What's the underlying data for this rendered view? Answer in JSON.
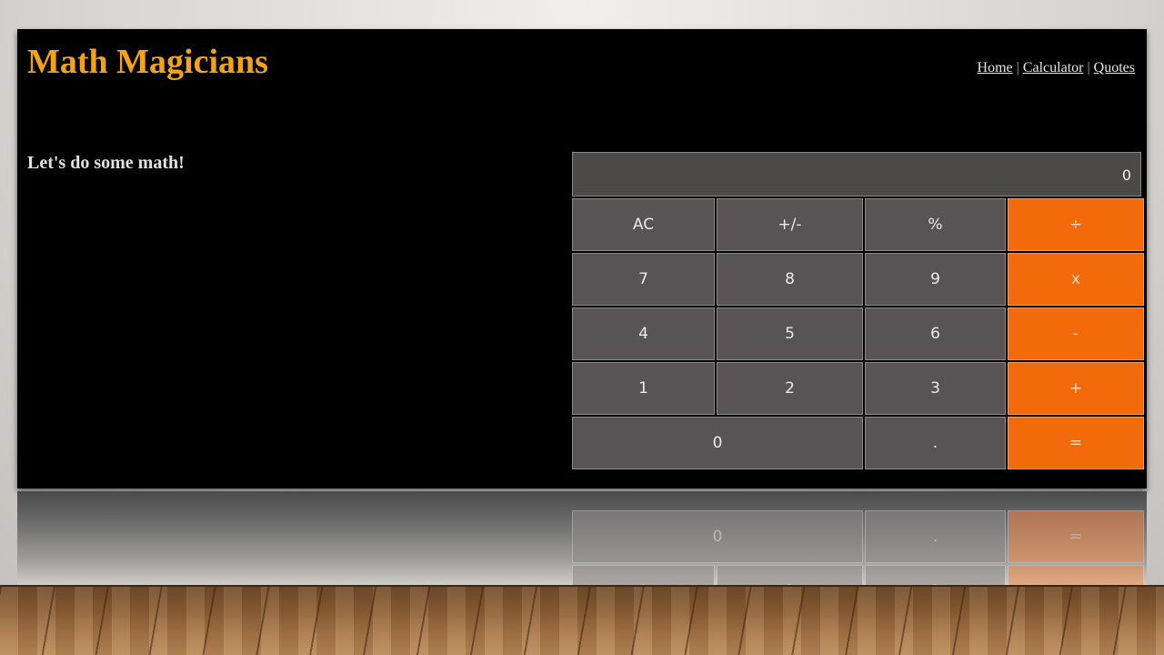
{
  "header": {
    "title": "Math Magicians",
    "nav": [
      {
        "label": "Home"
      },
      {
        "label": "Calculator"
      },
      {
        "label": "Quotes"
      }
    ],
    "separator": "|"
  },
  "main": {
    "intro": "Let's do some math!"
  },
  "calculator": {
    "display": "0",
    "keys": {
      "ac": "AC",
      "sign": "+/-",
      "percent": "%",
      "divide": "÷",
      "seven": "7",
      "eight": "8",
      "nine": "9",
      "multiply": "x",
      "four": "4",
      "five": "5",
      "six": "6",
      "minus": "-",
      "one": "1",
      "two": "2",
      "three": "3",
      "plus": "+",
      "zero": "0",
      "dot": ".",
      "equals": "="
    }
  },
  "colors": {
    "brand": "#f4a21b",
    "operator": "#f26a0a",
    "key": "#585354",
    "display": "#4c4a49",
    "background": "#000000"
  }
}
